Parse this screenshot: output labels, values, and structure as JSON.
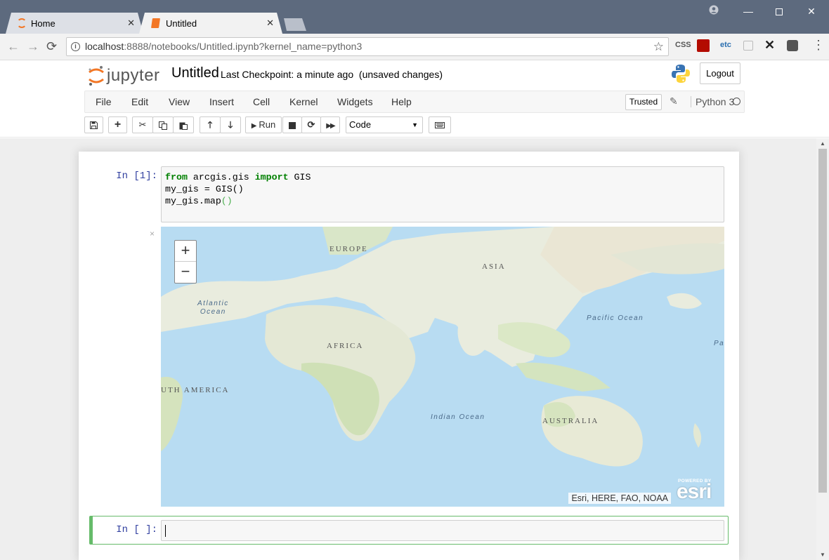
{
  "browser": {
    "tabs": [
      {
        "label": "Home"
      },
      {
        "label": "Untitled"
      }
    ],
    "url": {
      "host": "localhost",
      "rest": ":8888/notebooks/Untitled.ipynb?kernel_name=python3"
    },
    "extensions": [
      "CSS",
      "etc"
    ]
  },
  "header": {
    "logo_text": "jupyter",
    "notebook_name": "Untitled",
    "checkpoint": "Last Checkpoint: a minute ago",
    "unsaved": "(unsaved changes)",
    "logout_label": "Logout"
  },
  "menubar": {
    "items": [
      "File",
      "Edit",
      "View",
      "Insert",
      "Cell",
      "Kernel",
      "Widgets",
      "Help"
    ],
    "trusted_label": "Trusted",
    "kernel_name": "Python 3"
  },
  "toolbar": {
    "run_label": "Run",
    "cell_type": "Code",
    "icons": [
      "save-icon",
      "add-cell-icon",
      "cut-icon",
      "copy-icon",
      "paste-icon",
      "move-up-icon",
      "move-down-icon",
      "run-icon",
      "stop-icon",
      "restart-icon",
      "fast-forward-icon",
      "keyboard-icon"
    ]
  },
  "cells": [
    {
      "prompt": "In [1]:",
      "code": {
        "l1_kw1": "from",
        "l1_mid": " arcgis.gis ",
        "l1_kw2": "import",
        "l1_end": " GIS",
        "l2": "my_gis = GIS()",
        "l3_a": "my_gis.map",
        "l3_par": "()"
      },
      "output": {
        "close_glyph": "×",
        "map": {
          "zoom_in": "+",
          "zoom_out": "−",
          "labels": {
            "europe": "EUROPE",
            "asia": "ASIA",
            "africa": "AFRICA",
            "south_america": "UTH AMERICA",
            "australia": "AUSTRALIA",
            "atlantic_1": "Atlantic",
            "atlantic_2": "Ocean",
            "pacific": "Pacific Ocean",
            "pacific_edge": "Pa",
            "indian": "Indian Ocean"
          },
          "attribution": "Esri, HERE, FAO, NOAA",
          "powered_by": "POWERED BY",
          "esri_logo": "esri"
        }
      }
    },
    {
      "prompt": "In [ ]:",
      "code": ""
    }
  ]
}
